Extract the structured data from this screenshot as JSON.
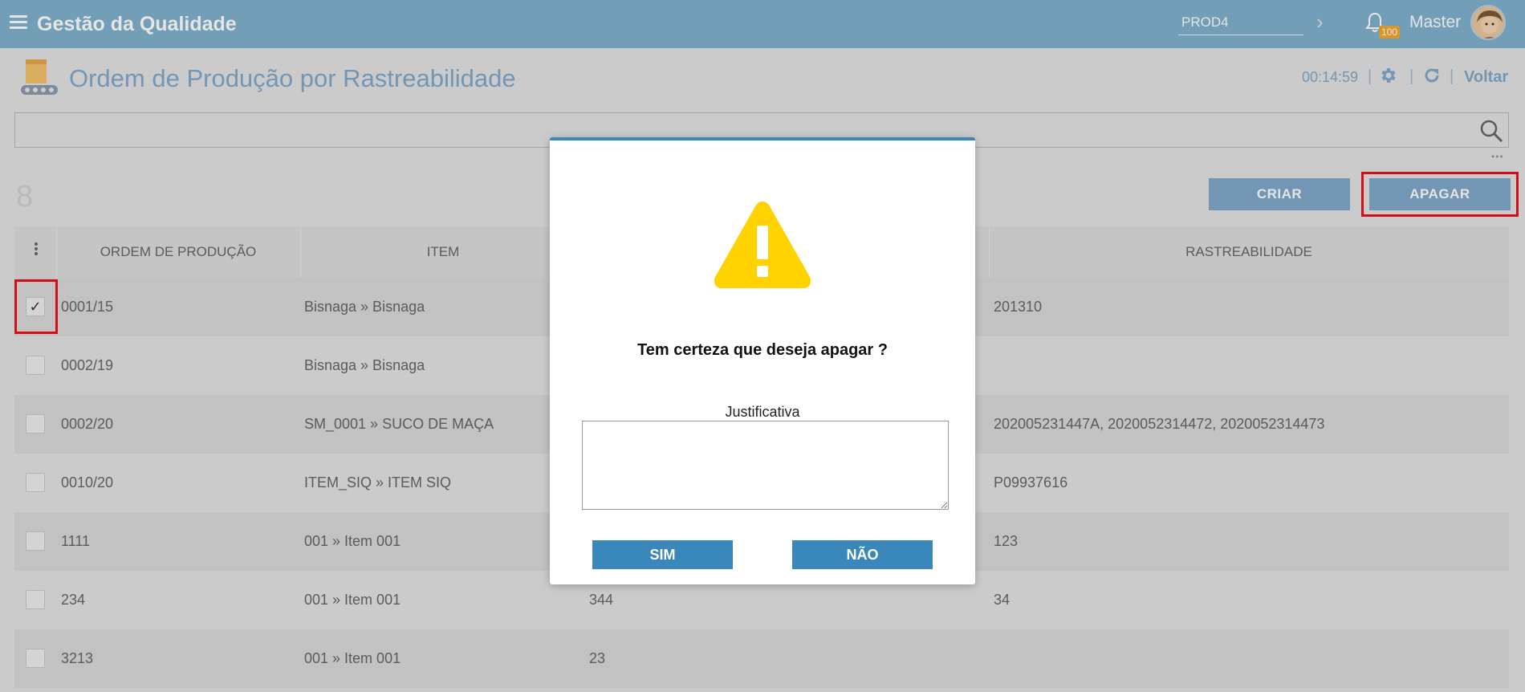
{
  "app": {
    "title": "Gestão da Qualidade"
  },
  "topbar": {
    "env_value": "PROD4",
    "notifications_count": "100",
    "user_name": "Master"
  },
  "page": {
    "title": "Ordem de Produção por Rastreabilidade",
    "timer": "00:14:59",
    "back_label": "Voltar",
    "search_value": "",
    "count": "8",
    "create_label": "CRIAR",
    "delete_label": "APAGAR"
  },
  "table": {
    "headers": {
      "order": "ORDEM DE PRODUÇÃO",
      "item": "ITEM",
      "traceability": "RASTREABILIDADE"
    },
    "rows": [
      {
        "order": "0001/15",
        "item": "Bisnaga » Bisnaga",
        "qty": "",
        "trace": "201310",
        "checked": true
      },
      {
        "order": "0002/19",
        "item": "Bisnaga » Bisnaga",
        "qty": "",
        "trace": "",
        "checked": false
      },
      {
        "order": "0002/20",
        "item": "SM_0001 » SUCO DE MAÇA",
        "qty": "",
        "trace": "202005231447A, 2020052314472, 2020052314473",
        "checked": false
      },
      {
        "order": "0010/20",
        "item": "ITEM_SIQ » ITEM SIQ",
        "qty": "",
        "trace": "P09937616",
        "checked": false
      },
      {
        "order": "1111",
        "item": "001 » Item 001",
        "qty": "",
        "trace": "123",
        "checked": false
      },
      {
        "order": "234",
        "item": "001 » Item 001",
        "qty": "344",
        "trace": "34",
        "checked": false
      },
      {
        "order": "3213",
        "item": "001 » Item 001",
        "qty": "23",
        "trace": "",
        "checked": false
      }
    ]
  },
  "dialog": {
    "message": "Tem certeza que deseja apagar ?",
    "justification_label": "Justificativa",
    "justification_value": "",
    "yes_label": "SIM",
    "no_label": "NÃO"
  },
  "colors": {
    "topbar": "#7fb0cc",
    "accent": "#3a87bb",
    "highlight": "#e8111b",
    "warning": "#ffd200"
  }
}
